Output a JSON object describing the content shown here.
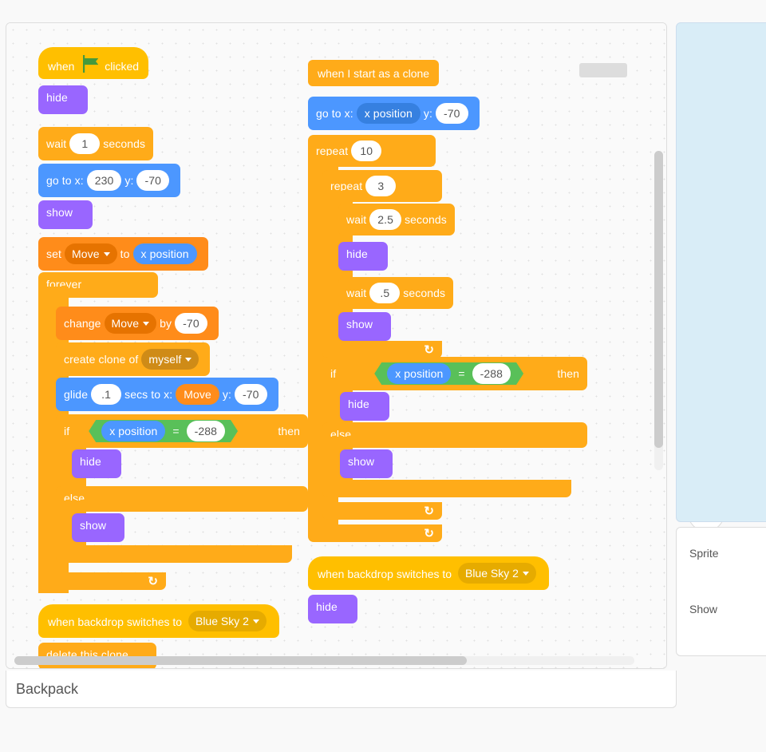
{
  "s1": {
    "whenClicked_pre": "when",
    "whenClicked_post": "clicked",
    "hide": "hide",
    "wait_pre": "wait",
    "wait_val": "1",
    "wait_post": "seconds",
    "goto_pre": "go to x:",
    "goto_x": "230",
    "goto_mid": "y:",
    "goto_y": "-70",
    "show": "show",
    "set_pre": "set",
    "set_var": "Move",
    "set_mid": "to",
    "set_val": "x position",
    "forever": "forever",
    "change_pre": "change",
    "change_var": "Move",
    "change_mid": "by",
    "change_val": "-70",
    "clone_pre": "create clone of",
    "clone_who": "myself",
    "glide_pre": "glide",
    "glide_s": ".1",
    "glide_mid": "secs to x:",
    "glide_var": "Move",
    "glide_y_lbl": "y:",
    "glide_y": "-70",
    "if": "if",
    "xpos": "x position",
    "cmp": "-288",
    "then": "then",
    "else": "else",
    "bd_pre": "when backdrop switches to",
    "bd_name": "Blue Sky 2",
    "delclone": "delete this clone"
  },
  "s2": {
    "startclone": "when I start as a clone",
    "goto_pre": "go to x:",
    "goto_x": "x position",
    "goto_mid": "y:",
    "goto_y": "-70",
    "repeat": "repeat",
    "repeat_n": "10",
    "repeat2_n": "3",
    "wait1_pre": "wait",
    "wait1_val": "2.5",
    "wait1_post": "seconds",
    "hide": "hide",
    "wait2_val": ".5",
    "show": "show",
    "if": "if",
    "xpos": "x position",
    "cmp": "-288",
    "then": "then",
    "else": "else",
    "bd_pre": "when backdrop switches to",
    "bd_name": "Blue Sky 2"
  },
  "panel": {
    "backpack": "Backpack",
    "sprite": "Sprite",
    "show": "Show"
  }
}
